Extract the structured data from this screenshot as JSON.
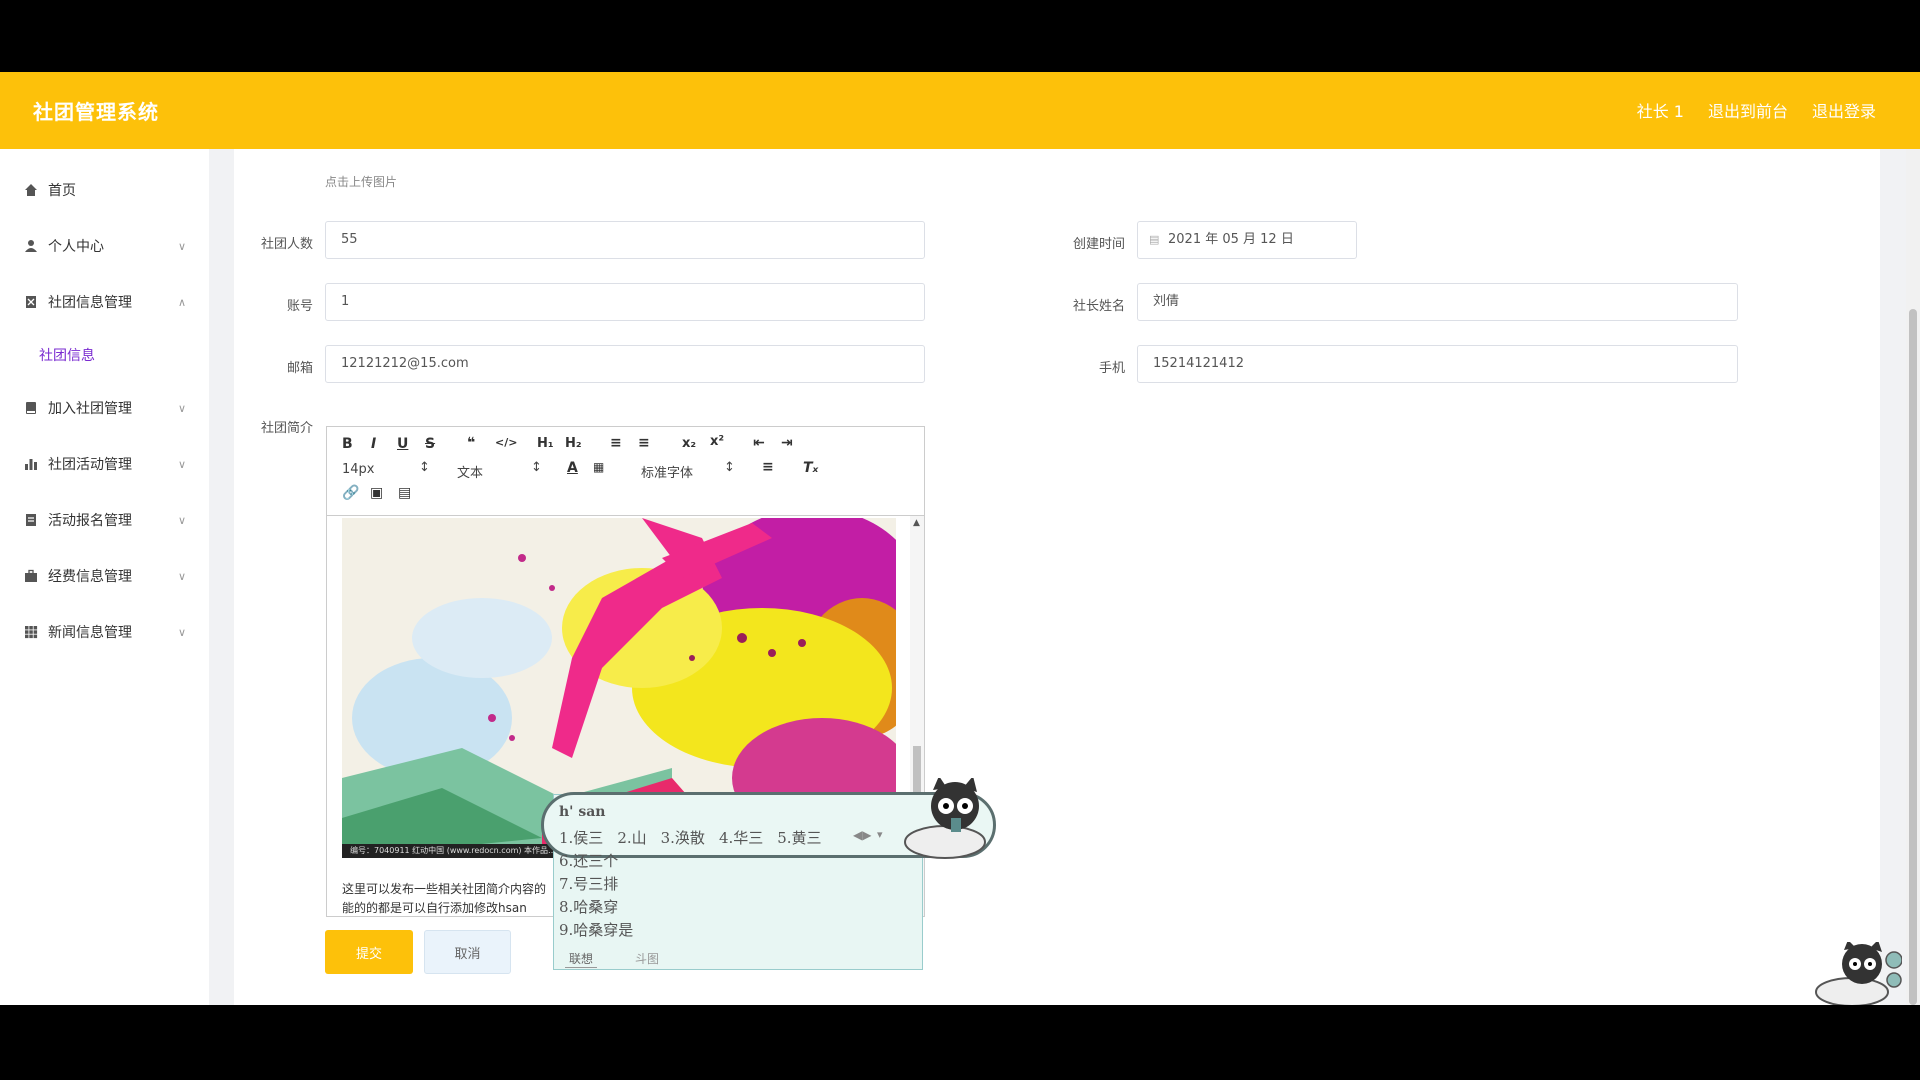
{
  "header": {
    "title": "社团管理系统",
    "nav": [
      "社长 1",
      "退出到前台",
      "退出登录"
    ]
  },
  "sidebar": {
    "items": [
      {
        "label": "首页",
        "icon": "home-icon"
      },
      {
        "label": "个人中心",
        "icon": "user-icon"
      },
      {
        "label": "社团信息管理",
        "icon": "clipboard-icon"
      },
      {
        "label": "加入社团管理",
        "icon": "book-icon"
      },
      {
        "label": "社团活动管理",
        "icon": "bar-chart-icon"
      },
      {
        "label": "活动报名管理",
        "icon": "document-icon"
      },
      {
        "label": "经费信息管理",
        "icon": "briefcase-icon"
      },
      {
        "label": "新闻信息管理",
        "icon": "grid-icon"
      }
    ],
    "sub_item": "社团信息"
  },
  "form": {
    "upload_hint": "点击上传图片",
    "members_label": "社团人数",
    "members_value": "55",
    "created_label": "创建时间",
    "created_value": "2021 年 05 月 12 日",
    "account_label": "账号",
    "account_value": "1",
    "leader_label": "社长姓名",
    "leader_value": "刘倩",
    "email_label": "邮箱",
    "email_value": "12121212@15.com",
    "phone_label": "手机",
    "phone_value": "15214121412",
    "intro_label": "社团简介"
  },
  "editor": {
    "font_size": "14px",
    "para_style": "文本",
    "font_family": "标准字体",
    "image_caption": "编号：7040911    红动中国 (www.redocn.com)    本作品…",
    "text_line1": "这里可以发布一些相关社团简介内容的",
    "text_line2": "能的的都是可以自行添加修改hsan"
  },
  "buttons": {
    "submit": "提交",
    "cancel": "取消"
  },
  "ime": {
    "input": "h' san",
    "candidates": [
      "1.侯三",
      "2.山",
      "3.涣散",
      "4.华三",
      "5.黄三"
    ],
    "more": [
      "6.还三个",
      "7.号三排",
      "8.哈桑穿",
      "9.哈桑穿是"
    ],
    "tab1": "联想",
    "tab2": "斗图"
  },
  "colors": {
    "accent": "#fdc10a",
    "sidebar_active": "#7a2bd0"
  }
}
